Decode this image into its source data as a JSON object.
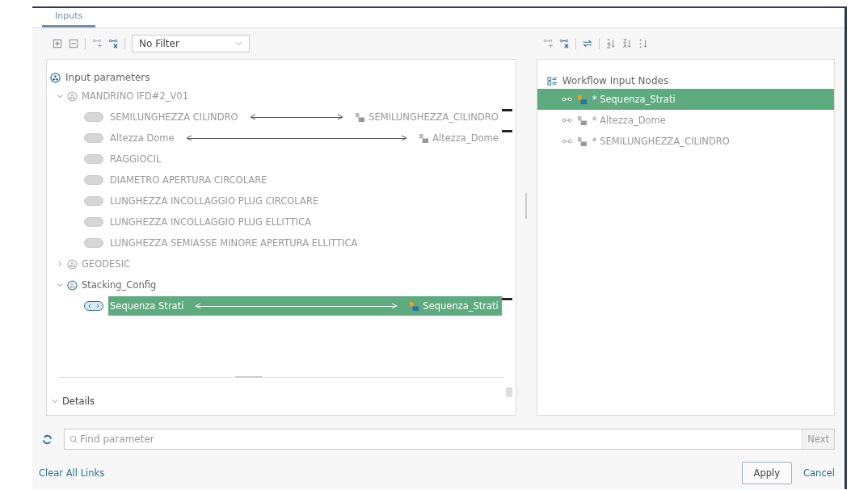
{
  "tab": {
    "label": "Inputs",
    "selected": true
  },
  "filter": {
    "value": "No Filter"
  },
  "tree": {
    "label": "Input parameters",
    "children": [
      {
        "label": "MANDRINO IFD#2_V01",
        "expanded": true,
        "children": [
          {
            "label": "SEMILUNGHEZZA CILINDRO",
            "link": "SEMILUNGHEZZA_CILINDRO",
            "selected": false
          },
          {
            "label": "Altezza Dome",
            "link": "Altezza_Dome",
            "selected": false
          },
          {
            "label": "RAGGIOCIL",
            "selected": false
          },
          {
            "label": "DIAMETRO APERTURA CIRCOLARE",
            "selected": false
          },
          {
            "label": "LUNGHEZZA INCOLLAGGIO PLUG CIRCOLARE",
            "selected": false
          },
          {
            "label": "LUNGHEZZA INCOLLAGGIO PLUG ELLITTICA",
            "selected": false
          },
          {
            "label": "LUNGHEZZA SEMIASSE MINORE APERTURA ELLITTICA",
            "selected": false
          }
        ]
      },
      {
        "label": "GEODESIC",
        "expanded": false
      },
      {
        "label": "Stacking_Config",
        "expanded": true,
        "children": [
          {
            "label": "Sequenza Strati",
            "link": "Sequenza_Strati",
            "selected": true
          }
        ]
      }
    ]
  },
  "details": {
    "label": "Details",
    "expanded": true
  },
  "workflow": {
    "title": "Workflow Input Nodes",
    "nodes": [
      {
        "label": "* Sequenza_Strati",
        "selected": true
      },
      {
        "label": "* Altezza_Dome",
        "selected": false
      },
      {
        "label": "* SEMILUNGHEZZA_CILINDRO",
        "selected": false
      }
    ]
  },
  "search": {
    "placeholder": "Find parameter",
    "next": "Next"
  },
  "footer": {
    "clear": "Clear All Links",
    "apply": "Apply",
    "cancel": "Cancel"
  }
}
